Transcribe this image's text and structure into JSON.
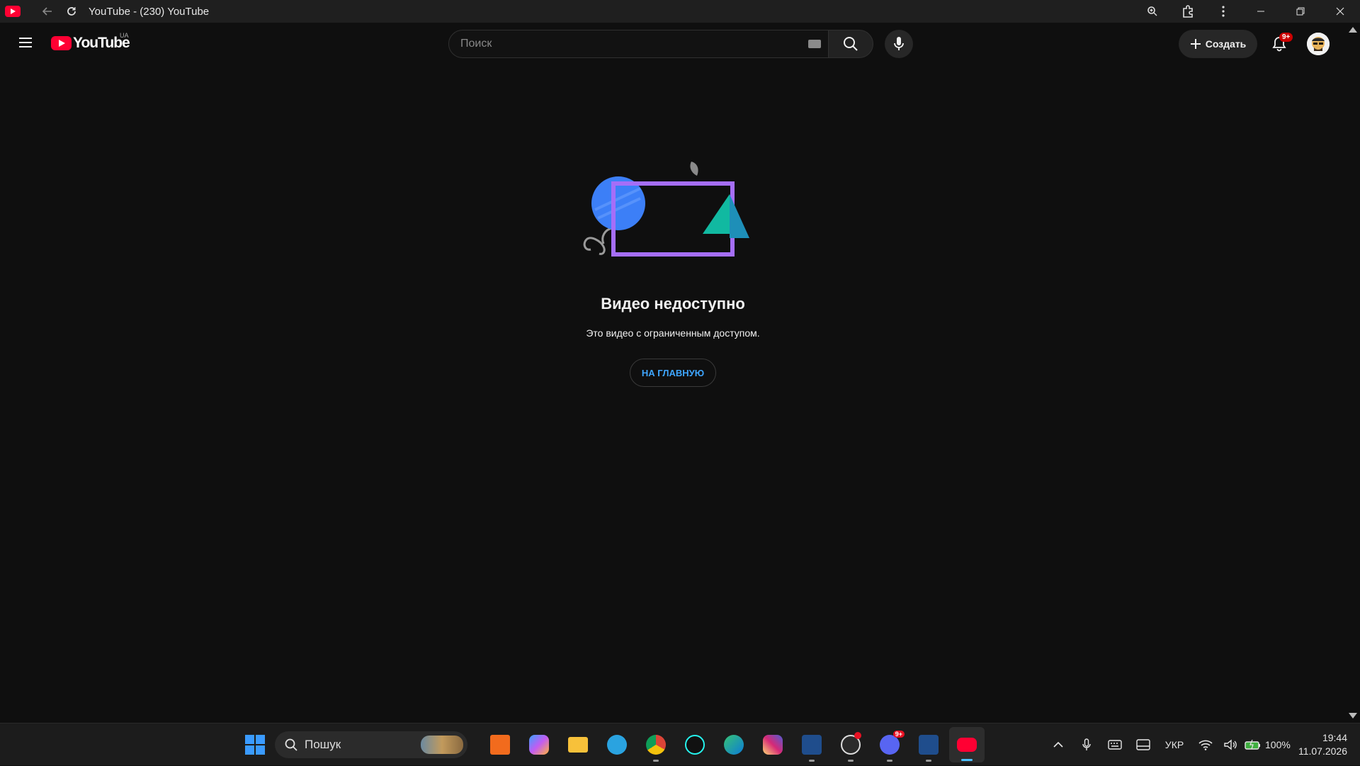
{
  "window": {
    "title": "YouTube - (230) YouTube"
  },
  "masthead": {
    "logo_text": "YouTube",
    "country_code": "UA",
    "search_placeholder": "Поиск",
    "create_label": "Создать",
    "notification_count": "9+"
  },
  "error": {
    "title": "Видео недоступно",
    "subtitle": "Это видео с ограниченным доступом.",
    "home_button": "НА ГЛАВНУЮ"
  },
  "taskbar": {
    "search_label": "Пошук",
    "apps": [
      "reader-app",
      "copilot",
      "file-explorer",
      "telegram",
      "chrome",
      "tiktok",
      "edge",
      "instagram",
      "azure-studio",
      "obs-studio",
      "discord",
      "azure-studio-2",
      "youtube"
    ],
    "discord_badge": "9+",
    "language": "УКР",
    "battery": "100%",
    "time": "19:44",
    "date": "11.07.2026"
  },
  "colors": {
    "background": "#0f0f0f",
    "accent_link": "#3ea6ff",
    "youtube_red": "#ff0033",
    "illustration_purple": "#a56ef8",
    "illustration_blue": "#3c7ff7",
    "illustration_teal": "#11b9a1"
  }
}
